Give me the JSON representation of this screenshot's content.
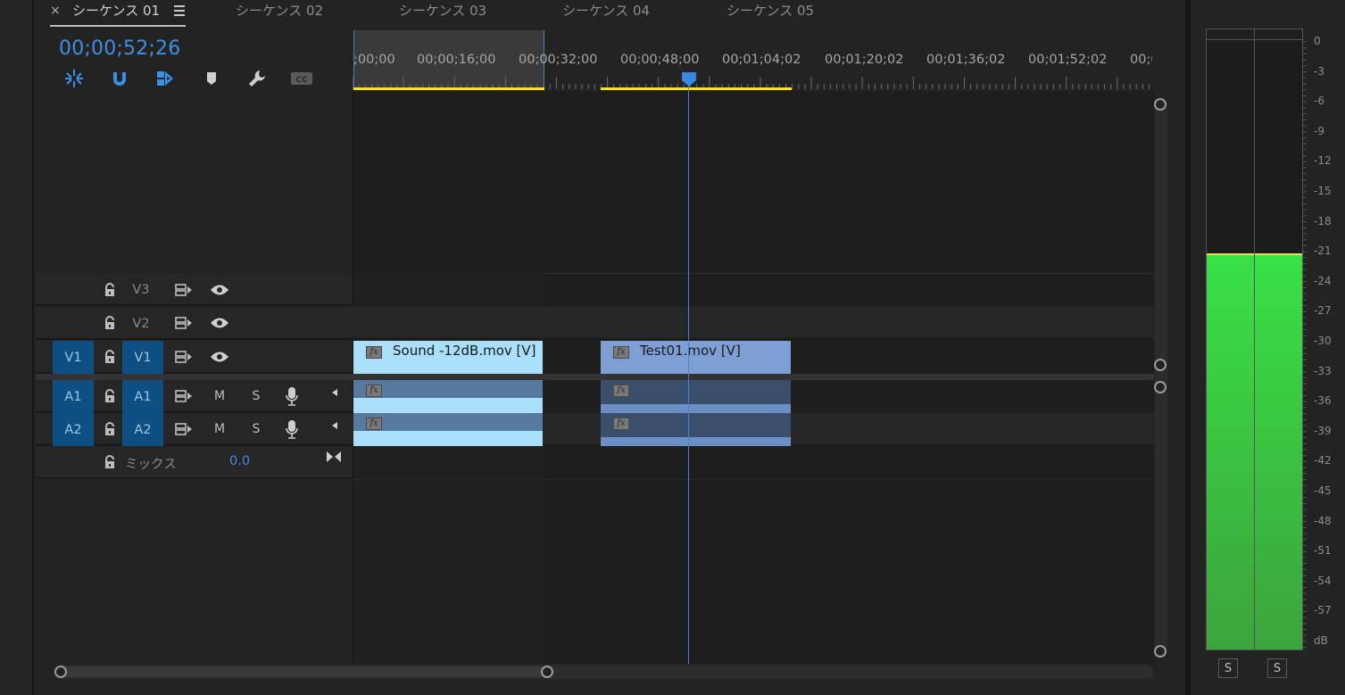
{
  "tabs": [
    {
      "label": "シーケンス 01",
      "active": true
    },
    {
      "label": "シーケンス 02",
      "active": false
    },
    {
      "label": "シーケンス 03",
      "active": false
    },
    {
      "label": "シーケンス 04",
      "active": false
    },
    {
      "label": "シーケンス 05",
      "active": false
    }
  ],
  "tab_close": "×",
  "timecode": "00;00;52;26",
  "toolbar": [
    "insert-snap-icon",
    "magnet-icon",
    "linked-selection-icon",
    "marker-icon",
    "wrench-icon",
    "captions-icon"
  ],
  "ruler": {
    "labels": [
      ";00;00",
      "00;00;16;00",
      "00;00;32;00",
      "00;00;48;00",
      "00;01;04;02",
      "00;01;20;02",
      "00;01;36;02",
      "00;01;52;02",
      "00;0"
    ]
  },
  "tracks": {
    "video": [
      {
        "label": "V3",
        "source": ""
      },
      {
        "label": "V2",
        "source": ""
      },
      {
        "label": "V1",
        "source": "V1"
      }
    ],
    "audio": [
      {
        "label": "A1",
        "source": "A1",
        "mute": "M",
        "solo": "S"
      },
      {
        "label": "A2",
        "source": "A2",
        "mute": "M",
        "solo": "S"
      }
    ],
    "mix": {
      "label": "ミックス",
      "value": "0.0"
    }
  },
  "clips": {
    "video": [
      {
        "name": "Sound -12dB.mov [V]",
        "fx": "fx"
      },
      {
        "name": "Test01.mov [V]",
        "fx": "fx"
      }
    ],
    "audio_fx": "fx"
  },
  "meter": {
    "scale": [
      "0",
      "-3",
      "-6",
      "-9",
      "-12",
      "-15",
      "-18",
      "-21",
      "-24",
      "-27",
      "-30",
      "-33",
      "-36",
      "-39",
      "-42",
      "-45",
      "-48",
      "-51",
      "-54",
      "-57",
      "dB"
    ],
    "level_db": -21,
    "solo_left": "S",
    "solo_right": "S",
    "colors": {
      "fill_top": "#39e046",
      "fill_bottom": "#3ca43c",
      "peak": "#e6e24a"
    }
  },
  "colors": {
    "accent": "#3d8fe6",
    "track_target": "#0d4f82",
    "clip_video_light": "#a9dffb",
    "clip_video_blue": "#7e9fd4",
    "work_bar": "#ffe414"
  }
}
